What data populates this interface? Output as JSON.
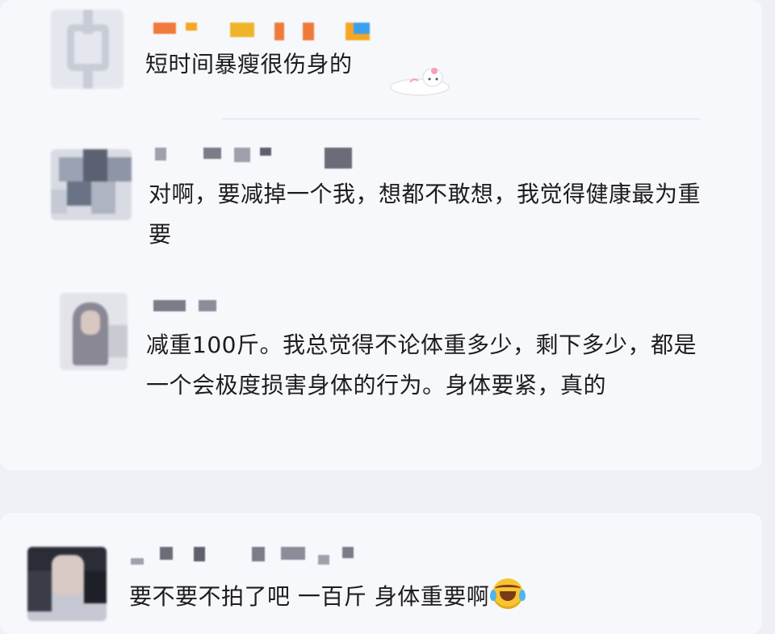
{
  "comments": [
    {
      "id": "c1",
      "text": "短时间暴瘦很伤身的",
      "sticker": "cat-sticker",
      "username_colors": [
        "#f07a3a",
        "#f5a623",
        "#f0b429",
        "#3aa0f0"
      ]
    },
    {
      "id": "c2",
      "text": "对啊，要减掉一个我，想都不敢想，我觉得健康最为重要",
      "username_colors": [
        "#6a6d78",
        "#4a4d58"
      ]
    },
    {
      "id": "c3",
      "text": "减重100斤。我总觉得不论体重多少，剩下多少，都是一个会极度损害身体的行为。身体要紧，真的",
      "username_colors": [
        "#6a6d78",
        "#4a4d58"
      ]
    },
    {
      "id": "c4",
      "text": "要不要不拍了吧 一百斤 身体重要啊",
      "emoji": "laughing-crying-emoji",
      "username_colors": [
        "#6a6d78",
        "#4a4d58"
      ]
    }
  ],
  "colors": {
    "background": "#eef0f6",
    "card": "#f7f8fc",
    "text": "#1d1d1f",
    "divider": "#dcdfe8"
  }
}
